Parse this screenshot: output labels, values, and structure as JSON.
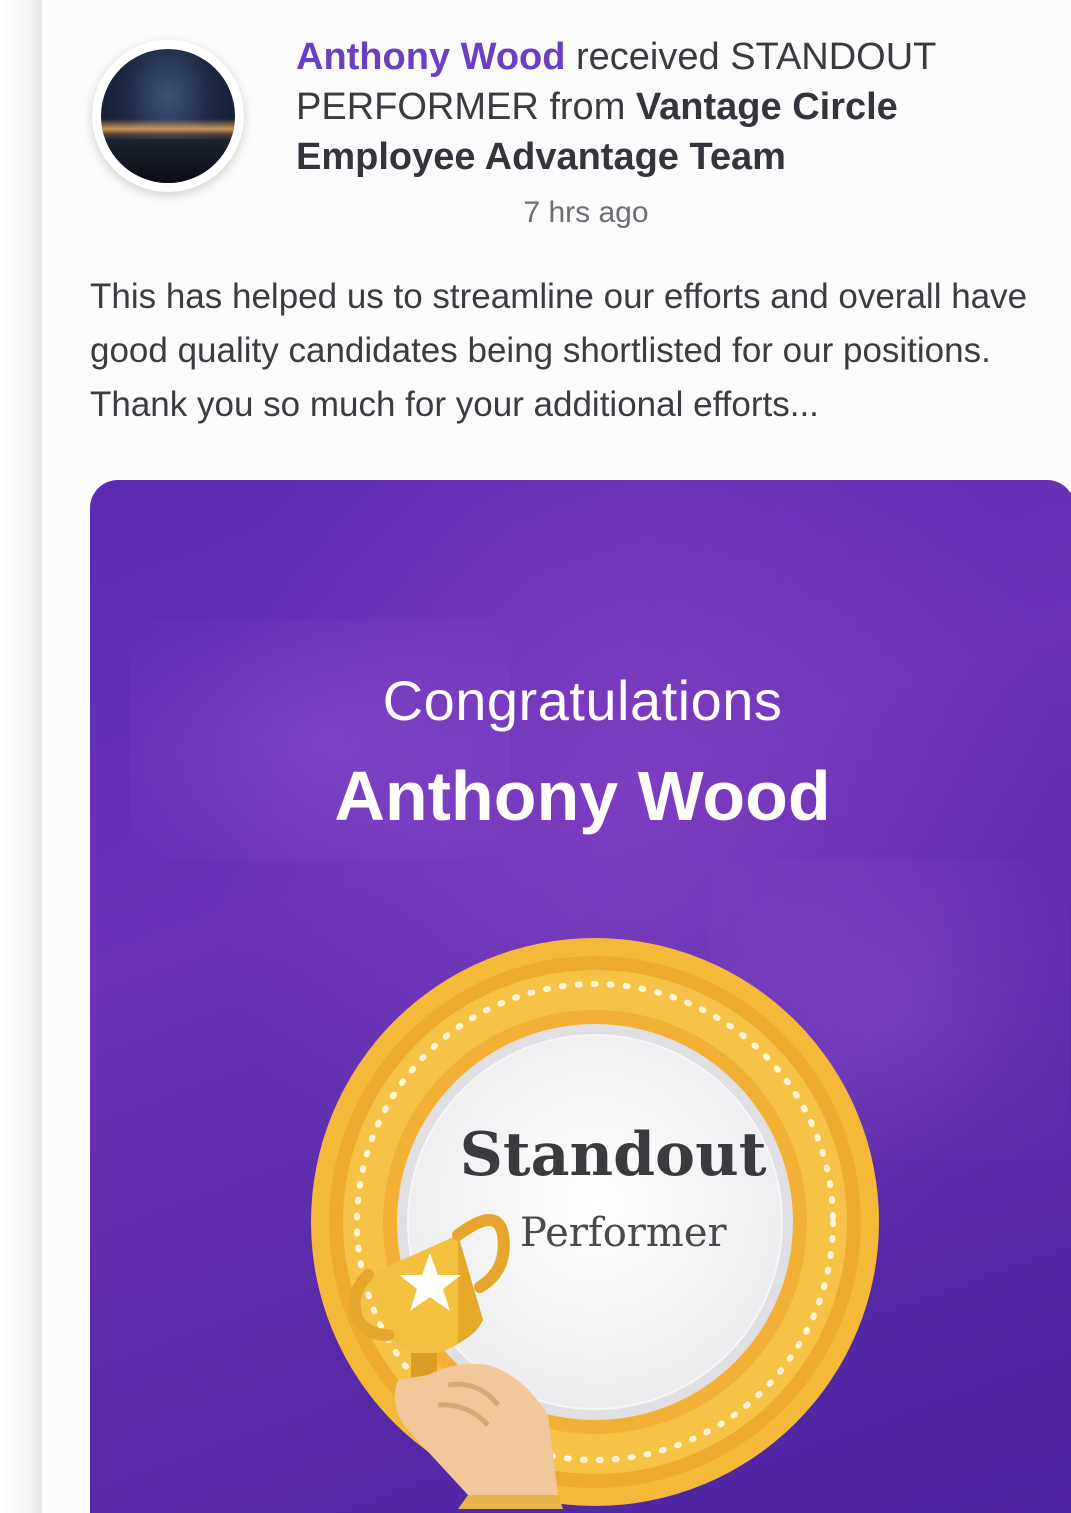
{
  "post": {
    "recipient_name": "Anthony Wood",
    "action_text": " received STANDOUT PERFORMER from ",
    "giver_team": "Vantage Circle Employee Advantage Team",
    "timestamp": "7 hrs ago",
    "message": "This has helped us to streamline our efforts and overall have good quality candidates being shortlisted for our positions. Thank you so much for your additional efforts..."
  },
  "award": {
    "congrats_label": "Congratulations",
    "recipient_name": "Anthony Wood",
    "badge_title": "Standout",
    "badge_subtitle": "Performer"
  },
  "colors": {
    "name_link": "#6b3fc1",
    "card_purple": "#5a2cb2",
    "badge_gold": "#f2b43a"
  },
  "icons": {
    "avatar": "user-avatar-photo",
    "trophy": "trophy-star-icon"
  }
}
